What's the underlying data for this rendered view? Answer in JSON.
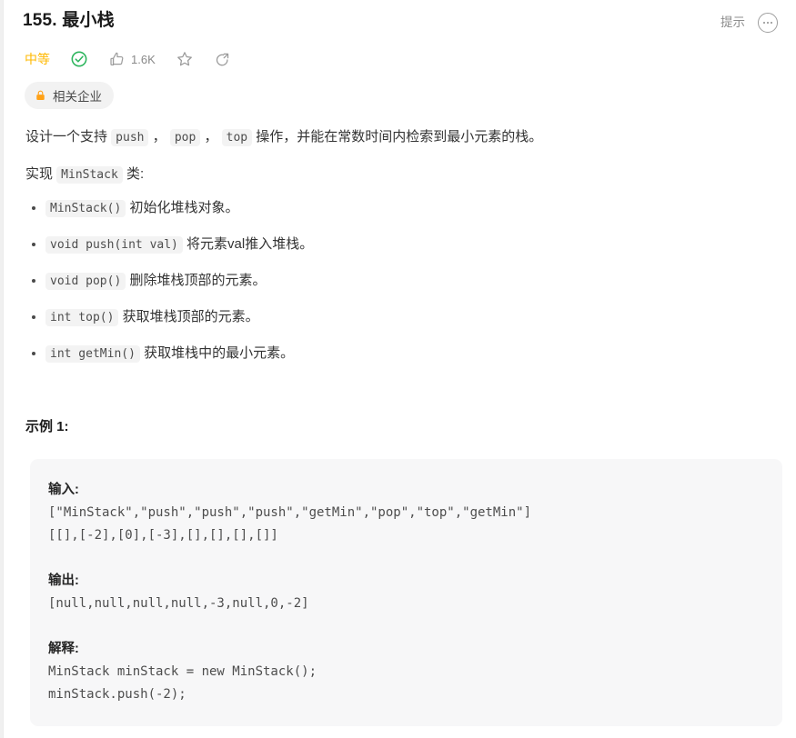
{
  "header": {
    "title": "155. 最小栈",
    "hint_label": "提示",
    "more_icon": "ellipsis-icon"
  },
  "meta": {
    "difficulty": "中等",
    "solved_icon": "check-circle-icon",
    "like_icon": "thumbs-up-icon",
    "like_count": "1.6K",
    "favorite_icon": "star-icon",
    "share_icon": "share-icon"
  },
  "company_tag": {
    "lock_icon": "lock-icon",
    "label": "相关企业"
  },
  "description": {
    "intro_prefix": "设计一个支持 ",
    "intro_code_1": "push",
    "intro_sep_1": " ， ",
    "intro_code_2": "pop",
    "intro_sep_2": " ， ",
    "intro_code_3": "top",
    "intro_suffix": " 操作，并能在常数时间内检索到最小元素的栈。",
    "implement_prefix": "实现 ",
    "implement_code": "MinStack",
    "implement_suffix": " 类:"
  },
  "api_list": [
    {
      "code": "MinStack()",
      "text": " 初始化堆栈对象。"
    },
    {
      "code": "void push(int val)",
      "text": " 将元素val推入堆栈。"
    },
    {
      "code": "void pop()",
      "text": " 删除堆栈顶部的元素。"
    },
    {
      "code": "int top()",
      "text": " 获取堆栈顶部的元素。"
    },
    {
      "code": "int getMin()",
      "text": " 获取堆栈中的最小元素。"
    }
  ],
  "example": {
    "title": "示例 1:",
    "input_label": "输入:",
    "input_line_1": "[\"MinStack\",\"push\",\"push\",\"push\",\"getMin\",\"pop\",\"top\",\"getMin\"]",
    "input_line_2": "[[],[-2],[0],[-3],[],[],[],[]]",
    "output_label": "输出:",
    "output_line_1": "[null,null,null,null,-3,null,0,-2]",
    "explain_label": "解释:",
    "explain_line_1": "MinStack minStack = new MinStack();",
    "explain_line_2": "minStack.push(-2);"
  },
  "colors": {
    "difficulty_orange": "#ffb800",
    "solved_green": "#00af9b",
    "lock_orange": "#ffa116",
    "code_bg": "#f7f7f8",
    "inline_code_bg": "#f3f3f3"
  }
}
